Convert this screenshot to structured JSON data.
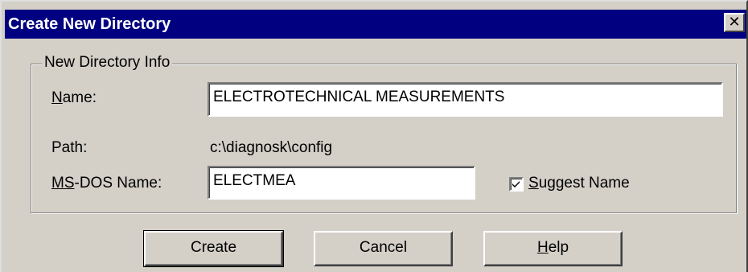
{
  "window": {
    "title": "Create New Directory",
    "close_glyph": "✕"
  },
  "group": {
    "legend": "New Directory Info"
  },
  "fields": {
    "name_label_mnemonic": "N",
    "name_label_rest": "ame:",
    "name_value": "ELECTROTECHNICAL MEASUREMENTS",
    "path_label": "Path:",
    "path_value": "c:\\diagnosk\\config",
    "dos_label_mnemonic": "MS",
    "dos_label_rest": "-DOS Name:",
    "dos_value": "ELECTMEA"
  },
  "suggest": {
    "checked": true,
    "label_mnemonic": "S",
    "label_rest": "uggest Name"
  },
  "buttons": {
    "create": "Create",
    "cancel": "Cancel",
    "help_mnemonic": "H",
    "help_rest": "elp"
  },
  "colors": {
    "titlebar": "#000080",
    "face": "#d4d0c8"
  },
  "icons": {
    "close": "close-icon",
    "check": "checkmark-icon"
  }
}
